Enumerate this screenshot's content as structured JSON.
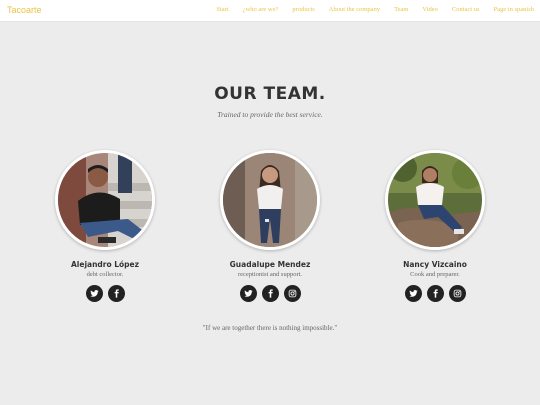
{
  "nav": {
    "brand": "Tacoarte",
    "links": [
      "Start",
      "¿who are we?",
      "products",
      "About the company",
      "Team",
      "Video",
      "Contact us",
      "Page in spanish"
    ]
  },
  "section": {
    "title": "OUR TEAM.",
    "subtitle": "Trained to provide the best service."
  },
  "members": [
    {
      "name": "Alejandro López",
      "role": "debt collector.",
      "socials": [
        "twitter-icon",
        "facebook-icon"
      ]
    },
    {
      "name": "Guadalupe Mendez",
      "role": "receptionist and support.",
      "socials": [
        "twitter-icon",
        "facebook-icon",
        "instagram-icon"
      ]
    },
    {
      "name": "Nancy Vizcaino",
      "role": "Cook and preparer.",
      "socials": [
        "twitter-icon",
        "facebook-icon",
        "instagram-icon"
      ]
    }
  ],
  "quote": "\"If we are together there is nothing impossible.\"",
  "colors": {
    "accent": "#e9c447",
    "background": "#ececec",
    "social_bg": "#222222"
  }
}
